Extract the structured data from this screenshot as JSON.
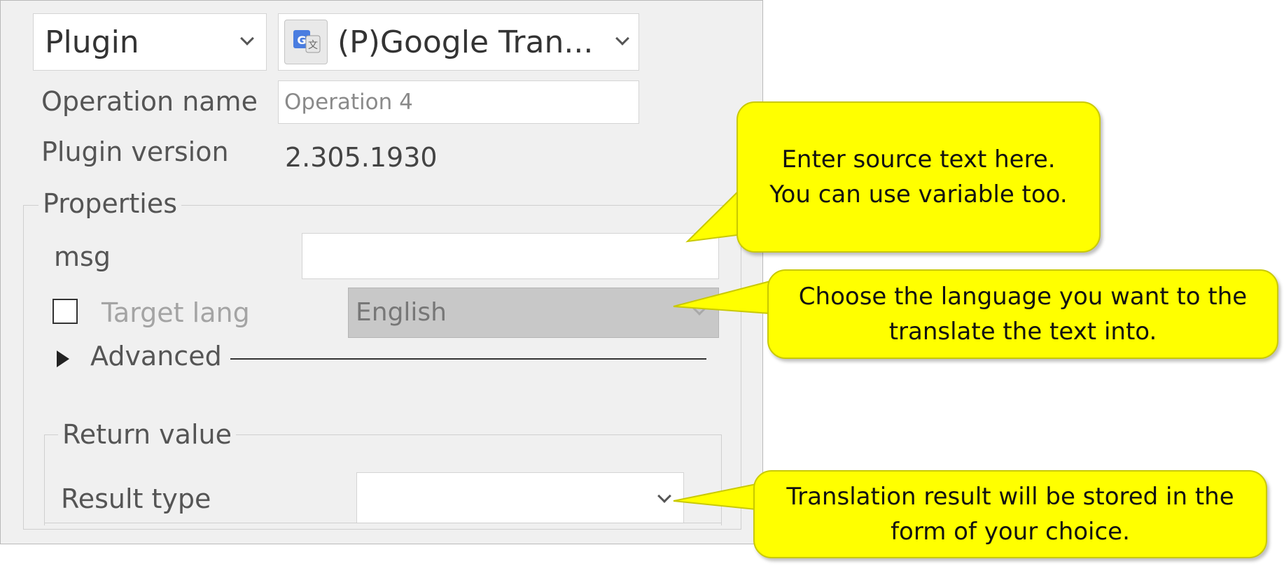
{
  "top": {
    "type_select": "Plugin",
    "plugin_select": "(P)Google Tran...",
    "plugin_icon": "google-translate-icon"
  },
  "form": {
    "operation_name_label": "Operation name",
    "operation_name_value": "Operation 4",
    "plugin_version_label": "Plugin version",
    "plugin_version_value": "2.305.1930"
  },
  "properties": {
    "legend": "Properties",
    "msg_label": "msg",
    "msg_value": "",
    "target_lang_label": "Target lang",
    "target_lang_checked": false,
    "target_lang_value": "English",
    "advanced_label": "Advanced"
  },
  "return_value": {
    "legend": "Return value",
    "result_type_label": "Result type",
    "result_type_value": ""
  },
  "callouts": {
    "msg": [
      "Enter source text here.",
      "You can use variable too."
    ],
    "lang": [
      "Choose the language you want to the",
      "translate the text into."
    ],
    "result": [
      "Translation result will be stored in the",
      "form of your choice."
    ]
  },
  "colors": {
    "callout_fill": "#ffff00",
    "panel_bg": "#f0f0f0",
    "disabled_select": "#c8c8c8"
  }
}
